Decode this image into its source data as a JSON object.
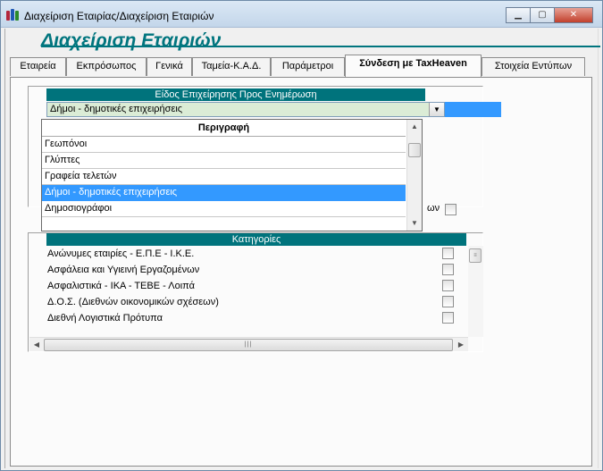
{
  "window": {
    "title": "Διαχείριση Εταιρίας/Διαχείριση Εταιριών",
    "controls": {
      "minimize": "▁",
      "maximize": "▢",
      "close": "✕"
    }
  },
  "page": {
    "title": "Διαχείριση Εταιριών"
  },
  "tabs": [
    {
      "label": "Εταιρεία",
      "active": false
    },
    {
      "label": "Εκπρόσωπος",
      "active": false
    },
    {
      "label": "Γενικά",
      "active": false
    },
    {
      "label": "Ταμεία-Κ.Α.Δ.",
      "active": false
    },
    {
      "label": "Παράμετροι",
      "active": false
    },
    {
      "label": "Σύνδεση με TaxHeaven",
      "active": true
    },
    {
      "label": "Στοιχεία Εντύπων",
      "active": false
    }
  ],
  "business_type": {
    "header": "Είδος Επιχείρησης Προς Ενημέρωση",
    "selected_value": "Δήμοι - δημοτικές επιχειρήσεις",
    "dropdown": {
      "column_header": "Περιγραφή",
      "options": [
        "Γεωπόνοι",
        "Γλύπτες",
        "Γραφεία τελετών",
        "Δήμοι - δημοτικές επιχειρήσεις",
        "Δημοσιογράφοι"
      ],
      "selected_index": 3
    },
    "partial_label": "ων"
  },
  "categories": {
    "header": "Κατηγορίες",
    "items": [
      {
        "label": "Ανώνυμες εταιρίες - Ε.Π.Ε - Ι.Κ.Ε.",
        "checked": false
      },
      {
        "label": "Ασφάλεια και Υγιεινή Εργαζομένων",
        "checked": false
      },
      {
        "label": "Ασφαλιστικά - ΙΚΑ - ΤΕΒΕ - Λοιπά",
        "checked": false
      },
      {
        "label": "Δ.Ο.Σ. (Διεθνών οικονομικών σχέσεων)",
        "checked": false
      },
      {
        "label": "Διεθνή Λογιστικά Πρότυπα",
        "checked": false
      }
    ]
  },
  "colors": {
    "accent": "#00737c",
    "selection": "#3399ff",
    "combo_bg": "#dbecd6"
  }
}
